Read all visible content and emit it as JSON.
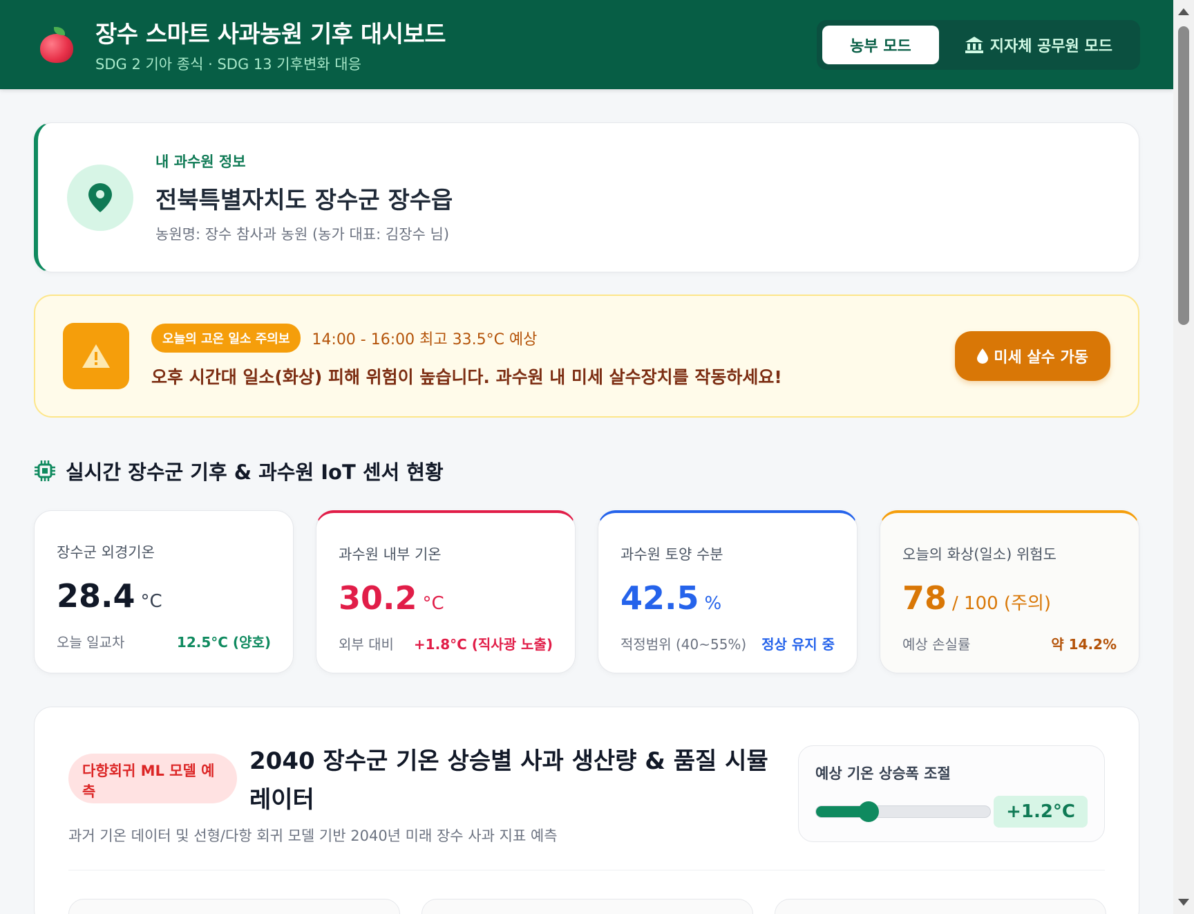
{
  "header": {
    "title": "장수 스마트 사과농원 기후 대시보드",
    "subtitle": "SDG 2 기아 종식 · SDG 13 기후변화 대응",
    "modes": [
      "농부 모드",
      "지자체 공무원 모드"
    ],
    "active_mode": "농부 모드"
  },
  "farm": {
    "label": "내 과수원 정보",
    "location": "전북특별자치도 장수군 장수읍",
    "owner": "농원명: 장수 참사과 농원 (농가 대표: 김장수 님)"
  },
  "alert": {
    "badge": "오늘의 고온 일소 주의보",
    "time": "14:00 - 16:00 최고 33.5°C 예상",
    "message": "오후 시간대 일소(화상) 피해 위험이 높습니다. 과수원 내 미세 살수장치를 작동하세요!",
    "button": "미세 살수 가동"
  },
  "sensors": {
    "section_title": "실시간 장수군 기후 & 과수원 IoT 센서 현황",
    "cards": [
      {
        "label": "장수군 외경기온",
        "value": "28.4",
        "unit": "°C",
        "foot_label": "오늘 일교차",
        "foot_value": "12.5°C (양호)",
        "accent": "#0f8a5f"
      },
      {
        "label": "과수원 내부 기온",
        "value": "30.2",
        "unit": "°C",
        "foot_label": "외부 대비",
        "foot_value": "+1.8°C (직사광 노출)",
        "accent": "#e11d48"
      },
      {
        "label": "과수원 토양 수분",
        "value": "42.5",
        "unit": "%",
        "foot_label": "적정범위 (40~55%)",
        "foot_value": "정상 유지 중",
        "accent": "#2563eb"
      },
      {
        "label": "오늘의 화상(일소) 위험도",
        "value": "78",
        "unit": "/ 100 (주의)",
        "foot_label": "예상 손실률",
        "foot_value": "약 14.2%",
        "accent": "#d97706"
      }
    ]
  },
  "simulator": {
    "badge": "다항회귀 ML 모델 예측",
    "title": "2040 장수군 기온 상승별 사과 생산량 & 품질 시뮬레이터",
    "description": "과거 기온 데이터 및 선형/다항 회귀 모델 기반 2040년 미래 장수 사과 지표 예측",
    "control_label": "예상 기온 상승폭 조절",
    "slider_value": "+1.2°C",
    "slider_fraction": 0.3
  }
}
